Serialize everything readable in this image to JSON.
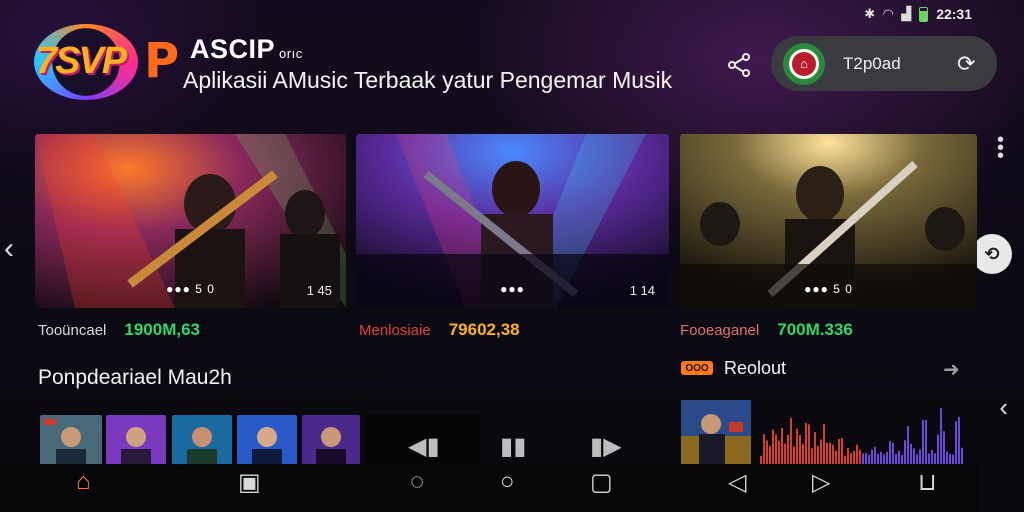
{
  "status_bar": {
    "time": "22:31",
    "icons": [
      "bluetooth-icon",
      "wifi-icon",
      "signal-icon",
      "battery-icon"
    ]
  },
  "header": {
    "logo_text": "7SVP",
    "logo_letter": "P",
    "brand_name": "ASCIP",
    "brand_suffix": "orıc",
    "tagline": "Aplikasii AMusic Terbaak yatur Pengemar Musik"
  },
  "account_pill": {
    "badge_text": "⌂",
    "label": "T2p0ad"
  },
  "featured_cards": [
    {
      "name": "Tooüncael",
      "value": "1900M,63",
      "value_color": "#2fd66b",
      "dots": "●●● 5 0",
      "count": "1 45"
    },
    {
      "name": "Menlosiaie",
      "value": "79602,38",
      "value_color": "#ffb21f",
      "dots": "●●●",
      "count": "1 14"
    },
    {
      "name": "Fooeaganel",
      "value": "700M.336",
      "value_color": "#2fd66b",
      "dots": "●●● 5 0",
      "count": ""
    }
  ],
  "sections": {
    "popular_title": "Ponpdeariael Mau2h",
    "recommended_badge": "OOO",
    "recommended_title": "Reolout"
  },
  "colors": {
    "accent_orange": "#ff6a1a",
    "accent_green": "#2fd66b",
    "accent_red": "#d6402a",
    "background": "#0d0a14"
  },
  "icons": {
    "nav": [
      "home-icon",
      "playlist-icon",
      "search-icon",
      "circle-icon",
      "square-icon",
      "speaker-icon",
      "play-icon",
      "cart-icon"
    ],
    "controls": [
      "previous-icon",
      "pause-icon",
      "next-icon"
    ]
  }
}
